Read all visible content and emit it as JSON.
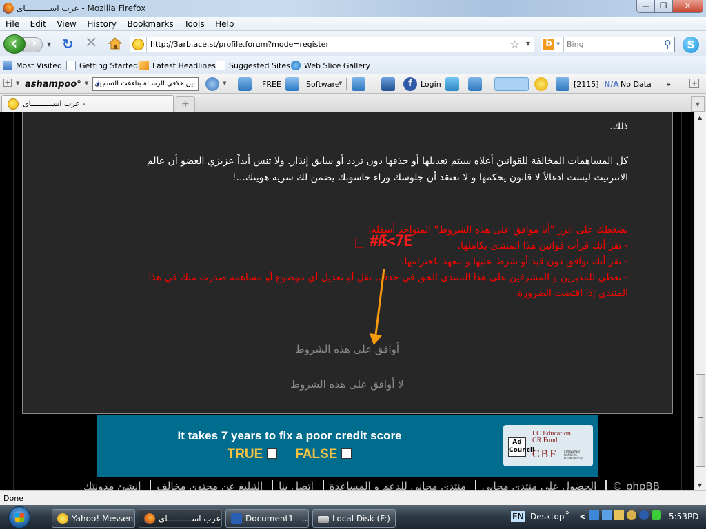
{
  "window": {
    "title": "عرب اســــــــــاى - Mozilla Firefox",
    "controls": {
      "minimize": "—",
      "restore": "❐",
      "close": "✕"
    }
  },
  "menu": [
    {
      "label": "File",
      "accel": "F"
    },
    {
      "label": "Edit",
      "accel": "E"
    },
    {
      "label": "View",
      "accel": "V"
    },
    {
      "label": "History",
      "accel": "s"
    },
    {
      "label": "Bookmarks",
      "accel": "B"
    },
    {
      "label": "Tools",
      "accel": "T"
    },
    {
      "label": "Help",
      "accel": "H"
    }
  ],
  "nav": {
    "url": "http://3arb.ace.st/profile.forum?mode=register",
    "search_placeholder": "Bing",
    "icons": {
      "back": "back-arrow-icon",
      "forward": "forward-arrow-icon",
      "reload": "reload-icon",
      "stop": "stop-icon",
      "home": "home-icon",
      "bookmark_star": "star-icon",
      "search": "magnifier-icon",
      "skype": "skype-icon"
    }
  },
  "bookmarks": [
    {
      "label": "Most Visited",
      "icon": "most-visited-icon"
    },
    {
      "label": "Getting Started",
      "icon": "page-icon"
    },
    {
      "label": "Latest Headlines",
      "icon": "rss-icon"
    },
    {
      "label": "Suggested Sites",
      "icon": "page-icon"
    },
    {
      "label": "Web Slice Gallery",
      "icon": "ie-icon"
    }
  ],
  "ashampoo": {
    "logo": "ashampoo°",
    "select_value": "بين هلافي الرسالة بناءعث التسجيل",
    "free_label": "FREE",
    "software_label": "Software",
    "login_label": "Login",
    "counter_label": "[2115]",
    "na_label": "N/A",
    "nodata_label": "No Data",
    "more_label": "»"
  },
  "tabs": [
    {
      "title": "عرب اســــــــــاى -",
      "active": true
    }
  ],
  "page": {
    "para_top_tail": "ذلك.",
    "para_white": "كل المساهمات المخالفة للقوانين أعلاه سيتم تعديلها أو حذفها دون تردد أو سابق إنذار. ولا تنس أبداً عزيزي العضو أن عالم الانترنيت ليست ادغالاً لا قانون يحكمها و لا تعتقد أن جلوسك وراء حاسوبك يضمن لك سرية هويتك...!",
    "red_intro": "بضغطك على الزر \"أنا موافق على هذه الشروط\" المتواجد أسفله:",
    "red_items": [
      "- تقر أنك قرأت قوانين هذا المنتدى بكاملها.",
      "- تقر أنك توافق دون قيد أو شرط عليها و تتعهد باحترامها.",
      "- تعطي للمديرين و المشرفين على هذا المنتدى الحق في حذف, نقل أو تعديل أي موضوع أو مساهمة صدرت منك في هذا المنتدى إذا اقتضت الضرورة."
    ],
    "garbled_overlay": "#Æ<7E",
    "agree_label": "أوافق على هذه الشروط",
    "disagree_label": "لا أوافق على هذه الشروط",
    "annotation_color": "#f59a0c"
  },
  "ad": {
    "headline": "It takes 7 years to fix a poor credit score",
    "true_label": "TRUE",
    "false_label": "FALSE",
    "adcouncil": "Ad Council",
    "edu_line1": "LC Education",
    "edu_line2": "CR Fund.",
    "cbf": "CBF",
    "cbf_small": "CONSUMER BANKERS FOUNDATION",
    "bg_color": "#006c8e",
    "accent_color": "#f5c242"
  },
  "footer_links": [
    "phpBB ©",
    "الحصول على منتدى مجاني",
    "منتدى مجاني للدعم و المساعدة",
    "اتصل بنا",
    "التبليغ عن محتوى مخالف",
    "انشئ مدونتك"
  ],
  "status": {
    "text": "Done"
  },
  "taskbar": {
    "buttons": [
      {
        "label": "Yahoo! Messen...",
        "icon": "yahoo-messenger-icon",
        "active": false
      },
      {
        "label": "عرب اســــــــــاى -...",
        "icon": "firefox-icon",
        "active": true
      },
      {
        "label": "Document1 - ...",
        "icon": "word-icon",
        "active": false
      },
      {
        "label": "Local Disk (F:)",
        "icon": "drive-icon",
        "active": false
      }
    ],
    "lang": "EN",
    "desktop_label": "Desktop",
    "more": "»",
    "collapse": "<",
    "clock": "5:53PD"
  }
}
